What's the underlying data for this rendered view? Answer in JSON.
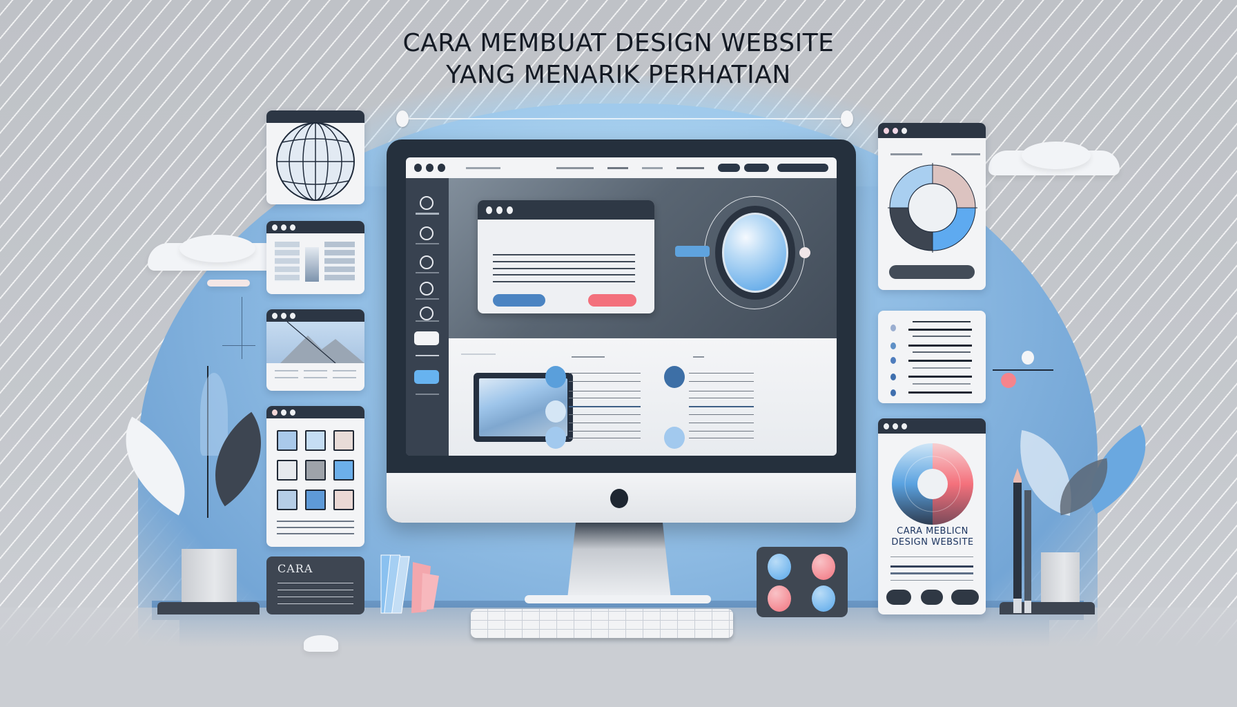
{
  "title": {
    "line1": "CARA MEMBUAT DESIGN WEBSITE",
    "line2": "YANG MENARIK PERHATIAN"
  },
  "colors": {
    "accent_blue": "#5fa3de",
    "accent_pink": "#f3707c",
    "dark_navy": "#25303d",
    "background_gray": "#c5c8cd",
    "sky_blue": "#8ebbe3"
  },
  "monitor": {
    "browser_nav": {
      "logo_text": "",
      "items": [
        "",
        "",
        "",
        ""
      ],
      "buttons": [
        "",
        "",
        ""
      ]
    },
    "sidebar": {
      "icons": [
        "profile-icon",
        "clock-icon",
        "shield-icon",
        "link-icon",
        "lock-icon"
      ]
    },
    "hero_card": {
      "primary_button": "",
      "secondary_button": ""
    },
    "columns": [
      "",
      "",
      ""
    ]
  },
  "right_panels": {
    "promo_card": {
      "heading_line1": "CARA MEBLICN",
      "heading_line2": "DESIGN WEBSITE"
    }
  },
  "left_panels": {
    "dark_card": {
      "heading": "CARA"
    }
  },
  "icons": {
    "globe": "globe-icon",
    "donut_chart": "donut-chart-icon",
    "color_wheel": "color-wheel-icon",
    "color_swatch": "color-swatch-icon",
    "pencil": "pencil-icon",
    "plant": "plant-icon",
    "cloud": "cloud-icon"
  }
}
